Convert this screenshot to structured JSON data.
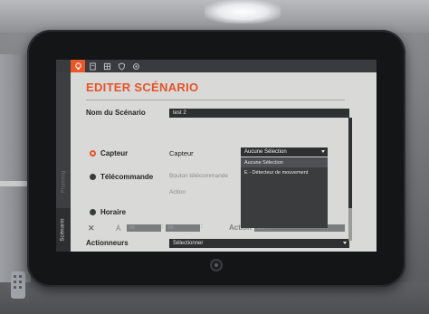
{
  "tabs": [
    {
      "icon": "lightbulb-icon",
      "active": true
    },
    {
      "icon": "document-icon",
      "active": false
    },
    {
      "icon": "grid-icon",
      "active": false
    },
    {
      "icon": "shield-icon",
      "active": false
    },
    {
      "icon": "settings-icon",
      "active": false
    }
  ],
  "sidebar": {
    "scenarios_tab": "Scénario",
    "inactive_tab": "Planning"
  },
  "editor": {
    "title": "EDITER SCÉNARIO",
    "name_label": "Nom du Scénario",
    "name_value": "test 2",
    "triggers": {
      "capteur": {
        "label": "Capteur",
        "selected": true,
        "field_label": "Capteur"
      },
      "telecommande": {
        "label": "Télécommande",
        "selected": false,
        "field_label": "Bouton télécommande",
        "action_label": "Action"
      },
      "horaire": {
        "label": "Horaire",
        "selected": false
      }
    },
    "capteur_dropdown": {
      "value": "Aucune Sélection",
      "options": [
        "Aucune Sélection",
        "E - Détecteur de mouvement"
      ]
    },
    "schedule": {
      "at_label": "À",
      "hour": "00",
      "minute": "00",
      "action_label": "Action",
      "action_value": "ON"
    },
    "actionneurs": {
      "label": "Actionneurs",
      "value": "Sélectionner"
    }
  },
  "colors": {
    "accent": "#e4542a",
    "panel": "#d9d9d7",
    "dark": "#2f3032"
  }
}
